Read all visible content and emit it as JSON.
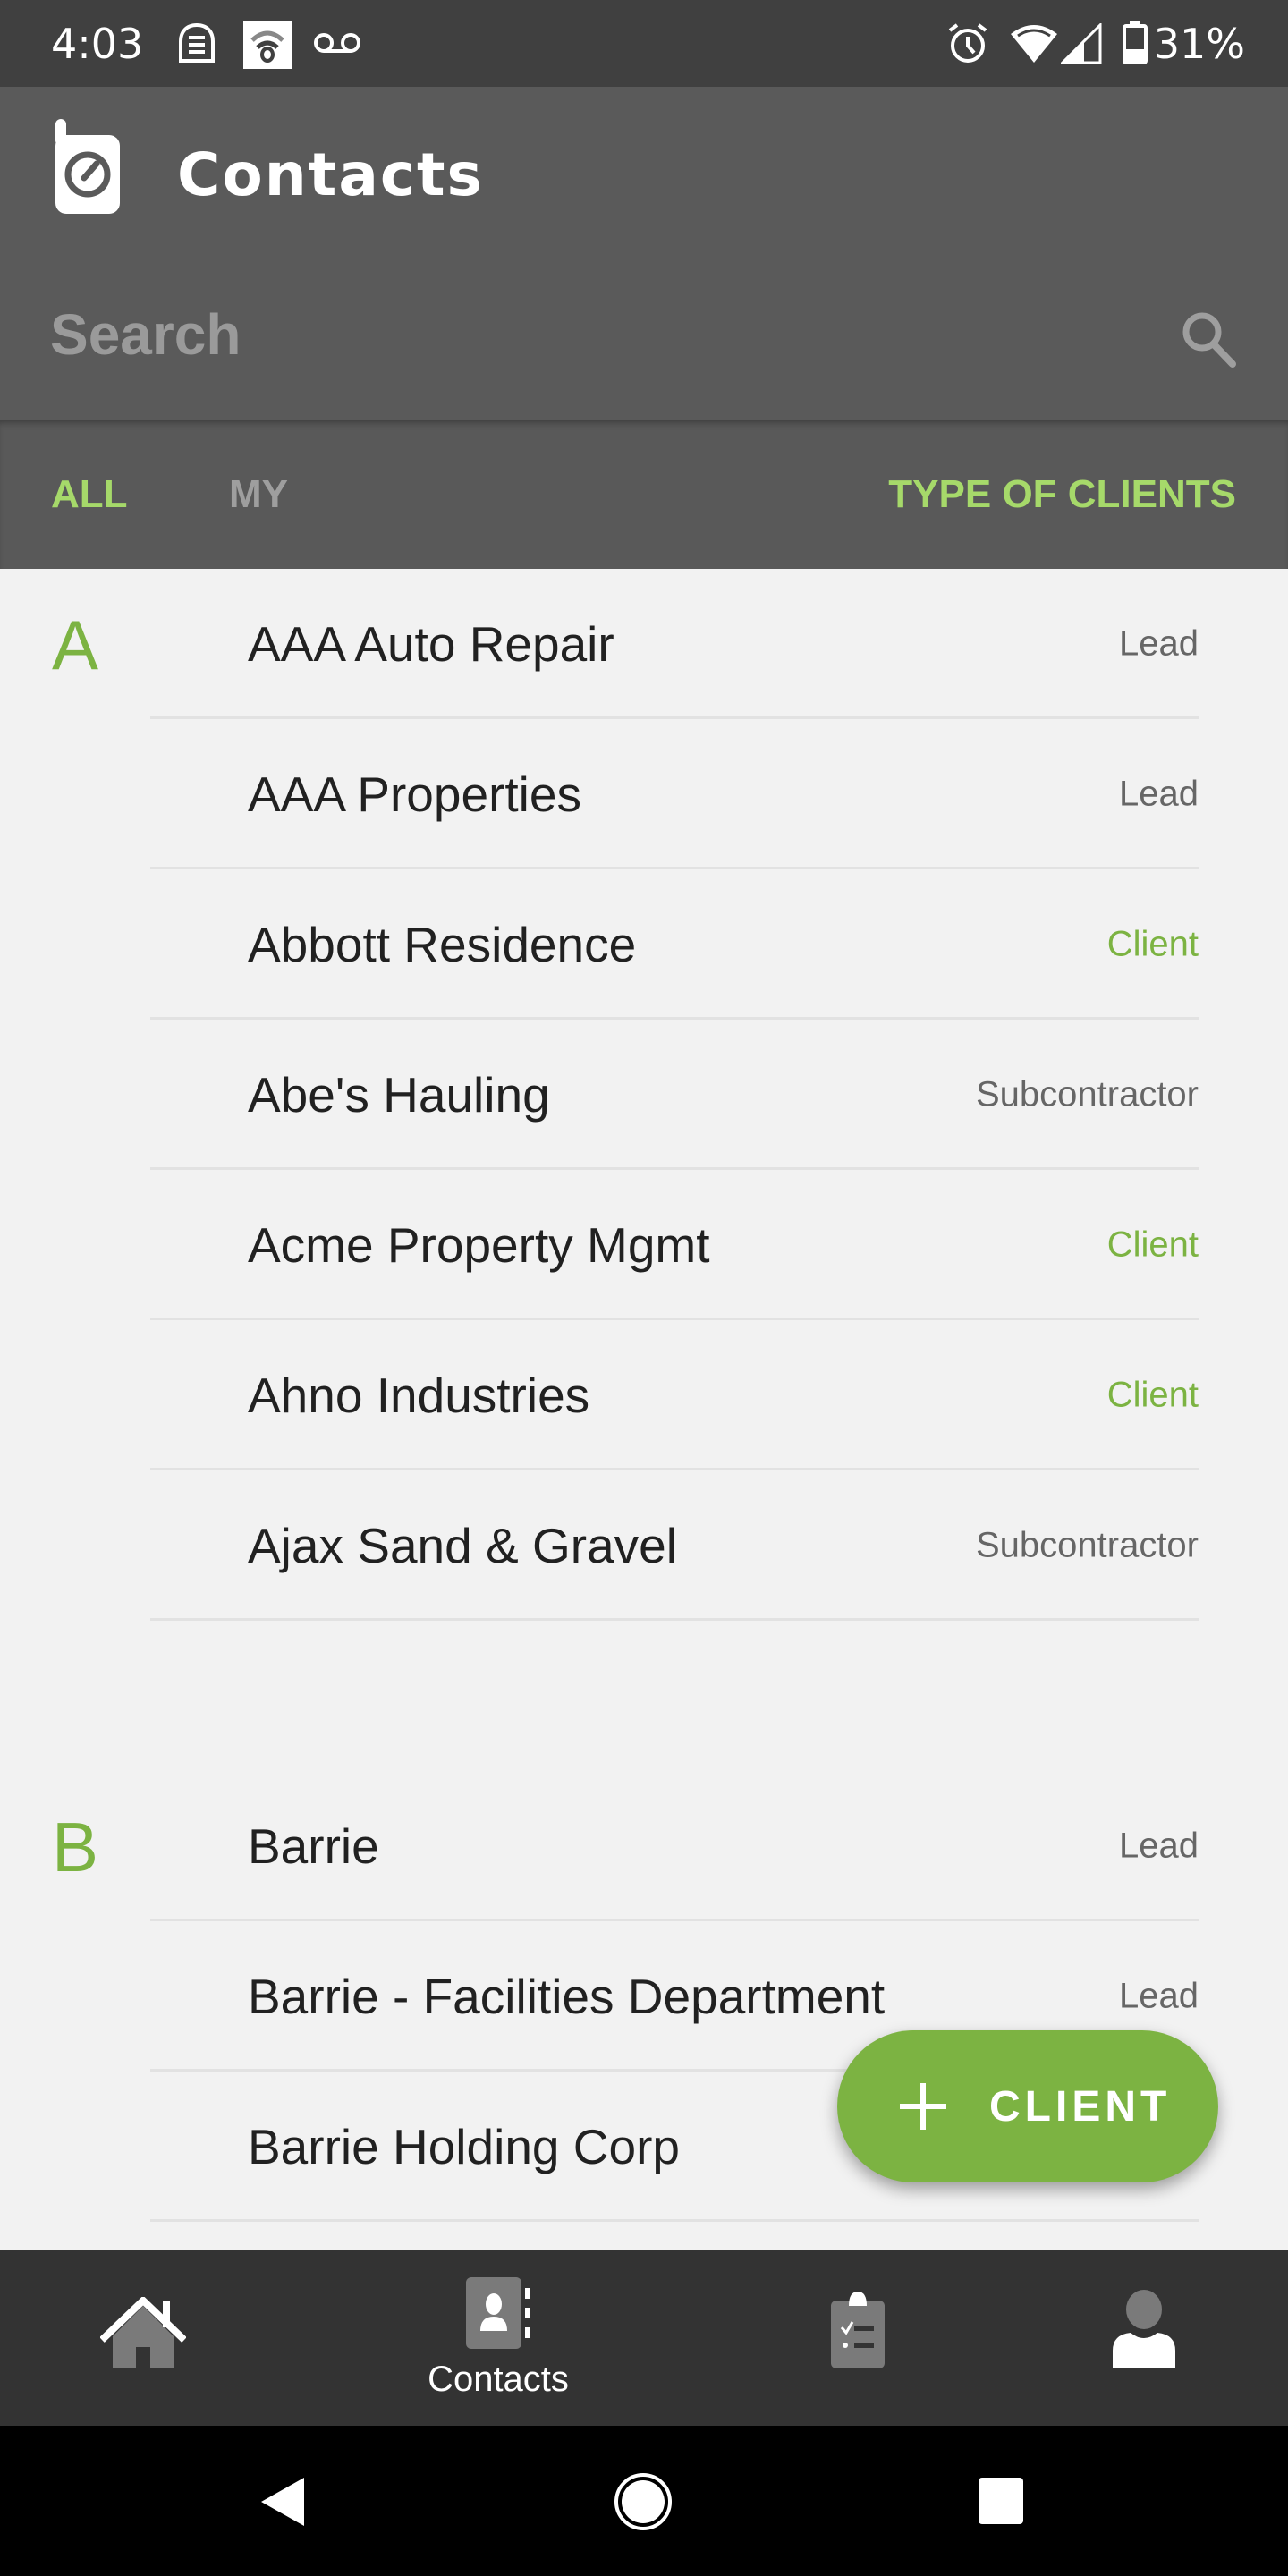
{
  "status_bar": {
    "time": "4:03",
    "left_icons": [
      "messages-icon",
      "hotspot-icon",
      "voicemail-icon"
    ],
    "right_icons": [
      "alarm-icon",
      "wifi-icon",
      "signal-icon",
      "battery-icon"
    ],
    "battery_percent": "31%"
  },
  "app_bar": {
    "logo_icon": "gauge-phone-logo-icon",
    "title": "Contacts",
    "search_placeholder": "Search",
    "search_value": "",
    "search_icon": "search-icon"
  },
  "filter_tabs": {
    "all": "ALL",
    "my": "MY",
    "type_of_clients": "TYPE OF CLIENTS",
    "active": "all"
  },
  "colors": {
    "accent": "#7cb342",
    "accent_light": "#a6d96a",
    "header_bg": "#5a5a5a",
    "status_bar_bg": "#404040",
    "list_bg": "#f2f2f2",
    "bottom_nav_bg": "#333333"
  },
  "sections": [
    {
      "letter": "A",
      "contacts": [
        {
          "name": "AAA Auto Repair",
          "type": "Lead"
        },
        {
          "name": "AAA Properties",
          "type": "Lead"
        },
        {
          "name": "Abbott Residence",
          "type": "Client"
        },
        {
          "name": "Abe's Hauling",
          "type": "Subcontractor"
        },
        {
          "name": "Acme Property Mgmt",
          "type": "Client"
        },
        {
          "name": "Ahno Industries",
          "type": "Client"
        },
        {
          "name": "Ajax Sand & Gravel",
          "type": "Subcontractor"
        }
      ]
    },
    {
      "letter": "B",
      "contacts": [
        {
          "name": "Barrie",
          "type": "Lead"
        },
        {
          "name": "Barrie - Facilities Department",
          "type": "Lead"
        },
        {
          "name": "Barrie Holding Corp",
          "type": ""
        }
      ]
    }
  ],
  "fab": {
    "icon": "plus-icon",
    "label": "CLIENT"
  },
  "bottom_nav": {
    "items": [
      {
        "id": "home",
        "icon": "home-icon",
        "label": ""
      },
      {
        "id": "contacts",
        "icon": "contacts-book-icon",
        "label": "Contacts",
        "active": true
      },
      {
        "id": "tasks",
        "icon": "clipboard-checklist-icon",
        "label": ""
      },
      {
        "id": "profile",
        "icon": "person-icon",
        "label": ""
      }
    ]
  },
  "system_nav": {
    "back": "back-icon",
    "home": "home-circle-icon",
    "recents": "recents-icon"
  }
}
